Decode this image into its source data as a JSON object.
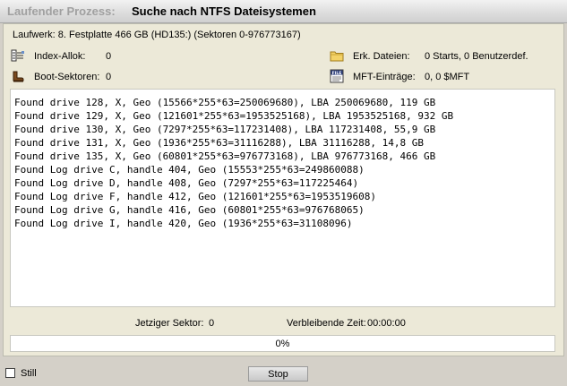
{
  "window": {
    "title_prefix": "Laufender Prozess:",
    "title": "Suche nach NTFS Dateisystemen"
  },
  "drive": {
    "label": "Laufwerk: 8. Festplatte 466 GB (HD135:) (Sektoren 0-976773167)"
  },
  "stats": {
    "index_alloc_label": "Index-Allok:",
    "index_alloc_value": "0",
    "boot_sectors_label": "Boot-Sektoren:",
    "boot_sectors_value": "0",
    "found_files_label": "Erk. Dateien:",
    "found_files_value": "0 Starts, 0 Benutzerdef.",
    "mft_entries_label": "MFT-Einträge:",
    "mft_entries_value": "0, 0 $MFT",
    "icons": {
      "index_alloc": "index-allocation-icon",
      "boot_sectors": "boot-sector-icon",
      "found_files": "folder-icon",
      "mft_entries": "file-icon"
    }
  },
  "log": {
    "lines": [
      "Found drive 128, X, Geo (15566*255*63=250069680), LBA 250069680, 119 GB",
      "Found drive 129, X, Geo (121601*255*63=1953525168), LBA 1953525168, 932 GB",
      "Found drive 130, X, Geo (7297*255*63=117231408), LBA 117231408, 55,9 GB",
      "Found drive 131, X, Geo (1936*255*63=31116288), LBA 31116288, 14,8 GB",
      "Found drive 135, X, Geo (60801*255*63=976773168), LBA 976773168, 466 GB",
      "Found Log drive C, handle 404, Geo (15553*255*63=249860088)",
      "Found Log drive D, handle 408, Geo (7297*255*63=117225464)",
      "Found Log drive F, handle 412, Geo (121601*255*63=1953519608)",
      "Found Log drive G, handle 416, Geo (60801*255*63=976768065)",
      "Found Log drive I, handle 420, Geo (1936*255*63=31108096)"
    ]
  },
  "status": {
    "current_sector_label": "Jetziger Sektor:",
    "current_sector_value": "0",
    "remaining_time_label": "Verbleibende Zeit:",
    "remaining_time_value": "00:00:00"
  },
  "progress": {
    "text": "0%",
    "percent": 0
  },
  "footer": {
    "still_label": "Still",
    "still_checked": false,
    "stop_label": "Stop"
  }
}
